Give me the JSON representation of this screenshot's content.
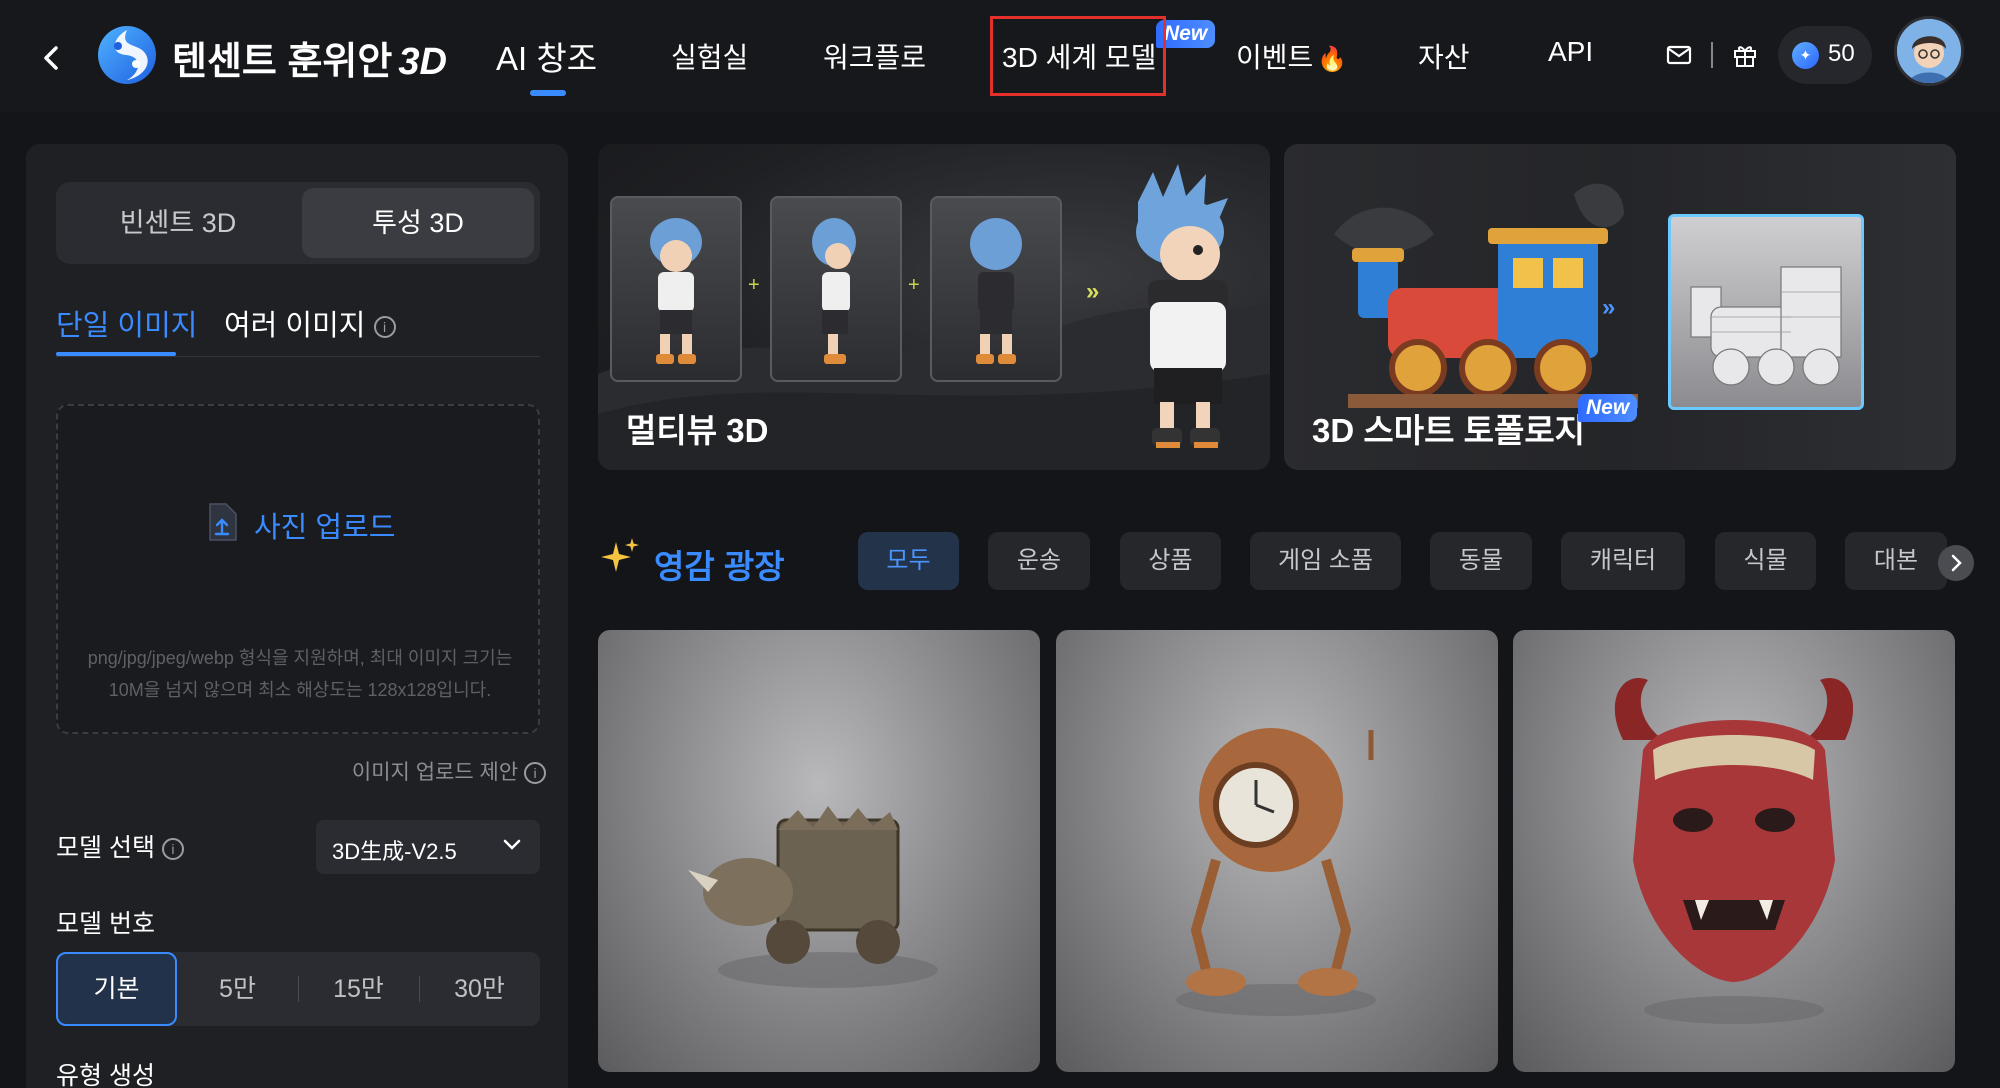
{
  "header": {
    "brand": "텐센트 훈위안",
    "brand_suffix": "3D",
    "nav": [
      {
        "label": "AI 창조"
      },
      {
        "label": "실험실"
      },
      {
        "label": "워크플로"
      },
      {
        "label": "3D 세계 모델"
      },
      {
        "label": "이벤트"
      },
      {
        "label": "자산"
      },
      {
        "label": "API"
      }
    ],
    "new_badge": "New",
    "fire_emoji": "🔥",
    "credits": "50"
  },
  "sidebar": {
    "segments": [
      "빈센트 3D",
      "투성 3D"
    ],
    "subtabs": [
      "단일 이미지",
      "여러 이미지"
    ],
    "upload": {
      "label": "사진 업로드",
      "hint": "png/jpg/jpeg/webp 형식을 지원하며, 최대 이미지 크기는 10M을 넘지 않으며 최소 해상도는 128x128입니다.",
      "suggestion": "이미지 업로드 제안"
    },
    "model_select_label": "모델 선택",
    "model_select_value": "3D生成-V2.5",
    "model_number_label": "모델 번호",
    "model_numbers": [
      "기본",
      "5만",
      "15만",
      "30만"
    ],
    "type_gen_label": "유형 생성"
  },
  "banners": [
    {
      "title": "멀티뷰 3D"
    },
    {
      "title": "3D 스마트 토폴로지",
      "badge": "New"
    }
  ],
  "plaza": {
    "title": "영감 광장",
    "categories": [
      "모두",
      "운송",
      "상품",
      "게임 소품",
      "동물",
      "캐릭터",
      "식물",
      "대본"
    ]
  },
  "colors": {
    "accent": "#3a8bff",
    "highlight_box": "#e3302c",
    "background": "#141518"
  }
}
